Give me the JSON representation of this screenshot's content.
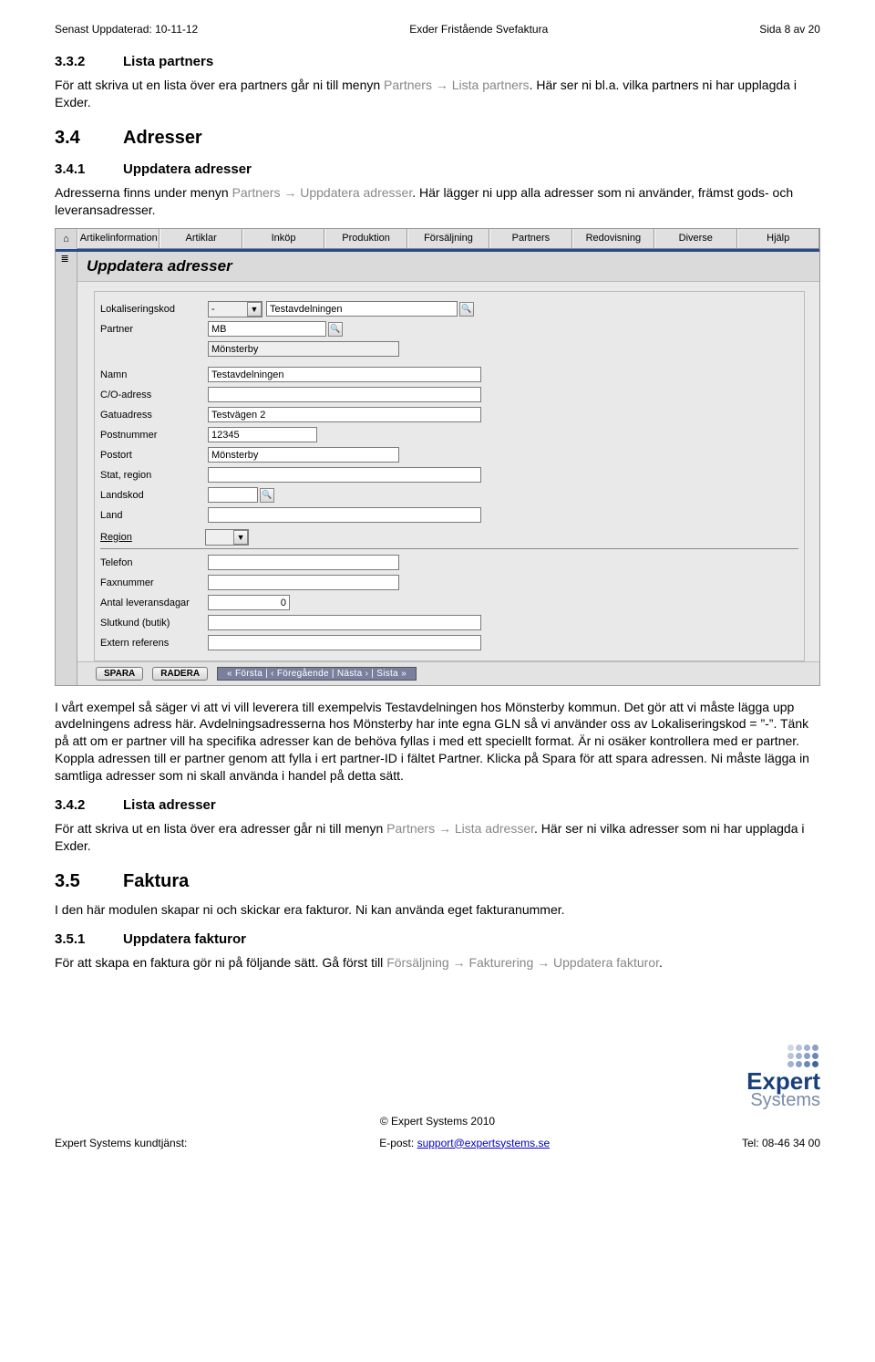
{
  "header": {
    "left": "Senast Uppdaterad: 10-11-12",
    "center": "Exder Fristående Svefaktura",
    "right": "Sida 8 av 20"
  },
  "sections": {
    "s332": {
      "num": "3.3.2",
      "title": "Lista partners"
    },
    "s34": {
      "num": "3.4",
      "title": "Adresser"
    },
    "s341": {
      "num": "3.4.1",
      "title": "Uppdatera adresser"
    },
    "s342": {
      "num": "3.4.2",
      "title": "Lista adresser"
    },
    "s35": {
      "num": "3.5",
      "title": "Faktura"
    },
    "s351": {
      "num": "3.5.1",
      "title": "Uppdatera fakturor"
    }
  },
  "para": {
    "p332a": "För att skriva ut en lista över era partners går ni till menyn ",
    "p332_path": "Partners → Lista partners",
    "p332b": ". Här ser ni bl.a. vilka partners ni har upplagda i Exder.",
    "p341a": "Adresserna finns under menyn ",
    "p341_path": "Partners → Uppdatera adresser",
    "p341b": ". Här lägger ni upp alla adresser som ni använder, främst gods- och leveransadresser.",
    "pexpl": "I vårt exempel så säger vi att vi vill leverera till exempelvis Testavdelningen hos Mönsterby kommun. Det gör att vi måste lägga upp avdelningens adress här. Avdelningsadresserna hos Mönsterby har inte egna GLN så vi använder oss av Lokaliseringskod = ”-”. Tänk på att om er partner vill ha specifika adresser kan de behöva fyllas i med ett speciellt format. Är ni osäker kontrollera med er partner. Koppla adressen till er partner genom att fylla i ert partner-ID i fältet Partner. Klicka på Spara för att spara adressen. Ni måste lägga in samtliga adresser som ni skall använda i handel på detta sätt.",
    "p342a": "För att skriva ut en lista över era adresser går ni till menyn ",
    "p342_path": "Partners → Lista adresser",
    "p342b": ". Här ser ni vilka adresser som ni har upplagda i Exder.",
    "p35": "I den här modulen skapar ni och skickar era fakturor. Ni kan använda eget fakturanummer.",
    "p351a": "För att skapa en faktura gör ni på följande sätt. Gå först till ",
    "p351_path": "Försäljning → Fakturering → Uppdatera fakturor",
    "p351b": "."
  },
  "app": {
    "menu": [
      "Artikelinformation (VCD)",
      "Artiklar",
      "Inköp",
      "Produktion",
      "Försäljning",
      "Partners",
      "Redovisning",
      "Diverse",
      "Hjälp"
    ],
    "title": "Uppdatera adresser",
    "form": {
      "lokaliseringskod_label": "Lokaliseringskod",
      "lokaliseringskod_sel": "-",
      "lokaliseringskod_name": "Testavdelningen",
      "partner_label": "Partner",
      "partner_code": "MB",
      "partner_name": "Mönsterby",
      "namn_label": "Namn",
      "namn_val": "Testavdelningen",
      "co_label": "C/O-adress",
      "co_val": "",
      "gatu_label": "Gatuadress",
      "gatu_val": "Testvägen 2",
      "postnr_label": "Postnummer",
      "postnr_val": "12345",
      "postort_label": "Postort",
      "postort_val": "Mönsterby",
      "stat_label": "Stat, region",
      "stat_val": "",
      "landskod_label": "Landskod",
      "landskod_val": "",
      "land_label": "Land",
      "land_val": "",
      "region_head": "Region",
      "telefon_label": "Telefon",
      "telefon_val": "",
      "fax_label": "Faxnummer",
      "fax_val": "",
      "levdagar_label": "Antal leveransdagar",
      "levdagar_val": "0",
      "slutkund_label": "Slutkund (butik)",
      "slutkund_val": "",
      "extref_label": "Extern referens",
      "extref_val": ""
    },
    "toolbar": {
      "spara": "SPARA",
      "radera": "RADERA",
      "pager": "«  Första  |  ‹  Föregående  |  Nästa  ›  |  Sista  »"
    }
  },
  "footer": {
    "copyright": "© Expert Systems 2010",
    "left_label": "Expert Systems kundtjänst:",
    "mid_label": "E-post: ",
    "mid_link": "support@expertsystems.se",
    "right": "Tel: 08-46 34 00",
    "logo_main": "Expert",
    "logo_sub": "Systems"
  }
}
